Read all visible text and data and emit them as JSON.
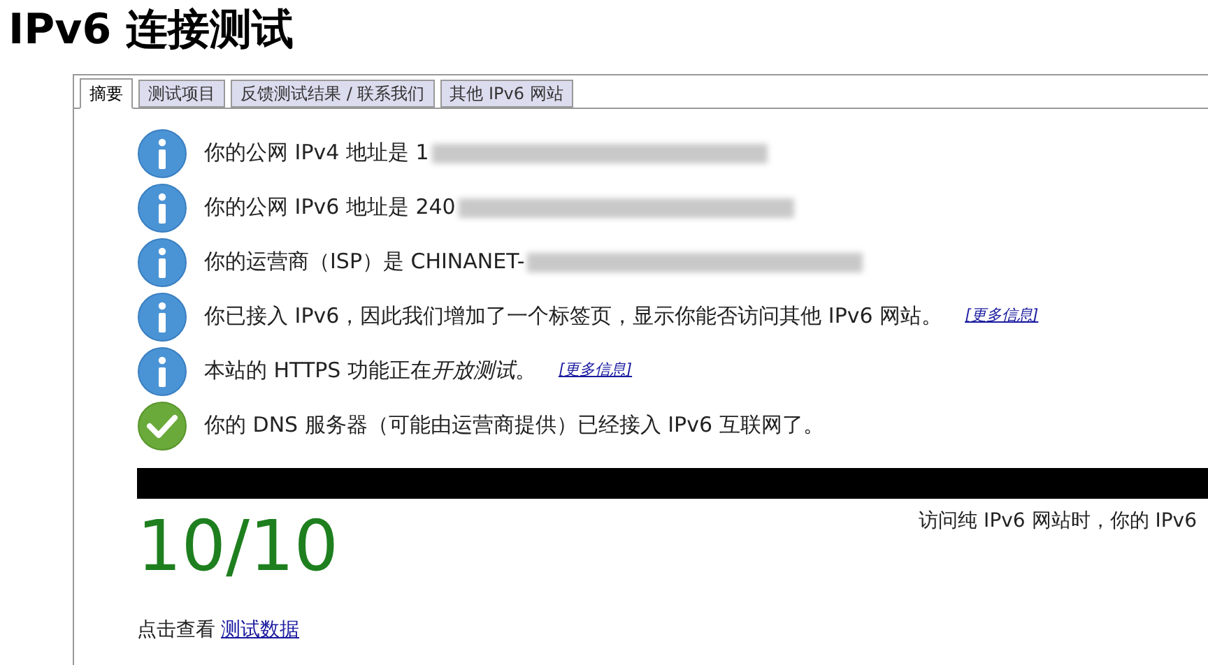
{
  "title": "IPv6 连接测试",
  "tabs": [
    {
      "label": "摘要",
      "selected": true
    },
    {
      "label": "测试项目",
      "selected": false
    },
    {
      "label": "反馈测试结果 / 联系我们",
      "selected": false
    },
    {
      "label": "其他 IPv6 网站",
      "selected": false
    }
  ],
  "messages": [
    {
      "kind": "info",
      "text": "你的公网 IPv4 地址是 1",
      "redacted": true
    },
    {
      "kind": "info",
      "text": "你的公网 IPv6 地址是 240",
      "redacted": true
    },
    {
      "kind": "info",
      "text": "你的运营商（ISP）是 CHINANET-",
      "redacted": true
    },
    {
      "kind": "info",
      "text": "你已接入 IPv6，因此我们增加了一个标签页，显示你能否访问其他 IPv6 网站。",
      "redacted": false,
      "link": "[更多信息]"
    },
    {
      "kind": "info",
      "text": "本站的 HTTPS 功能正在",
      "emphasis": "开放测试",
      "text_after": "。",
      "redacted": false,
      "link": "[更多信息]"
    },
    {
      "kind": "ok",
      "text": "你的 DNS 服务器（可能由运营商提供）已经接入 IPv6 互联网了。",
      "redacted": false
    }
  ],
  "score": "10/10",
  "score_note": "访问纯 IPv6 网站时，你的 IPv6",
  "footer": {
    "text": "点击查看",
    "link": "测试数据"
  }
}
